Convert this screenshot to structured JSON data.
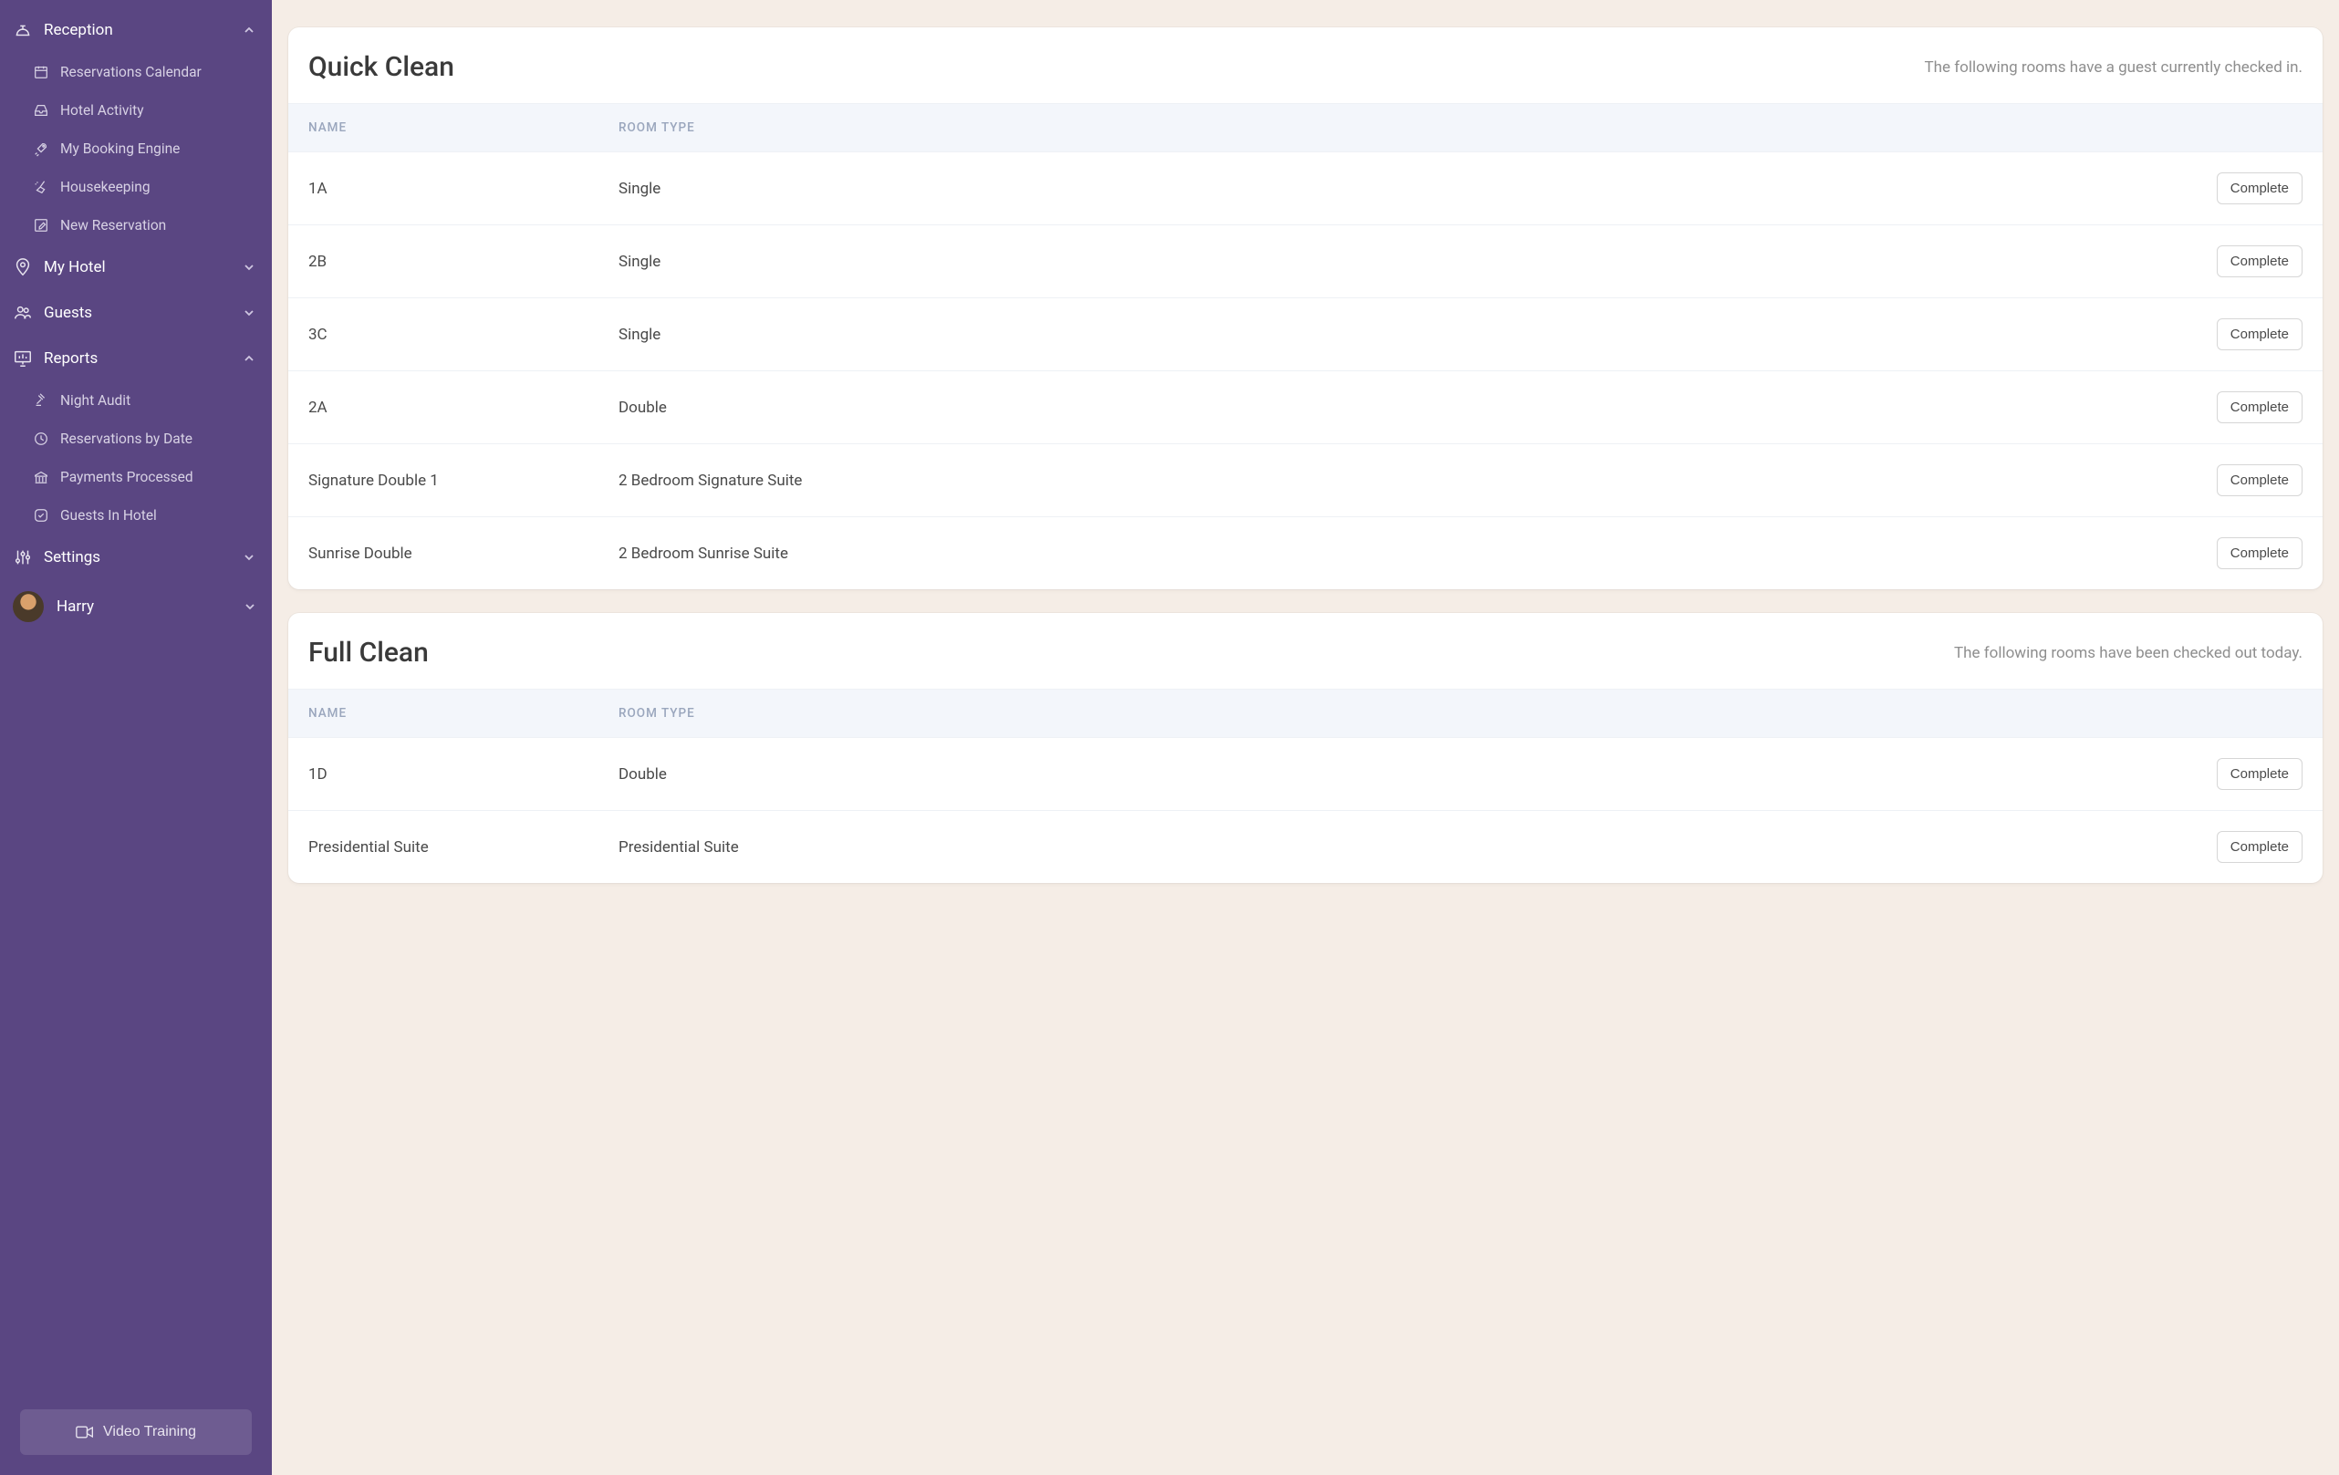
{
  "sidebar": {
    "reception": {
      "label": "Reception",
      "items": [
        {
          "label": "Reservations Calendar"
        },
        {
          "label": "Hotel Activity"
        },
        {
          "label": "My Booking Engine"
        },
        {
          "label": "Housekeeping"
        },
        {
          "label": "New Reservation"
        }
      ]
    },
    "my_hotel": {
      "label": "My Hotel"
    },
    "guests": {
      "label": "Guests"
    },
    "reports": {
      "label": "Reports",
      "items": [
        {
          "label": "Night Audit"
        },
        {
          "label": "Reservations by Date"
        },
        {
          "label": "Payments Processed"
        },
        {
          "label": "Guests In Hotel"
        }
      ]
    },
    "settings": {
      "label": "Settings"
    },
    "user": {
      "name": "Harry"
    },
    "video_training_label": "Video Training"
  },
  "quick_clean": {
    "title": "Quick Clean",
    "subtitle": "The following rooms have a guest currently checked in.",
    "columns": {
      "name": "Name",
      "type": "Room Type"
    },
    "complete_label": "Complete",
    "rows": [
      {
        "name": "1A",
        "type": "Single"
      },
      {
        "name": "2B",
        "type": "Single"
      },
      {
        "name": "3C",
        "type": "Single"
      },
      {
        "name": "2A",
        "type": "Double"
      },
      {
        "name": "Signature Double 1",
        "type": "2 Bedroom Signature Suite"
      },
      {
        "name": "Sunrise Double",
        "type": "2 Bedroom Sunrise Suite"
      }
    ]
  },
  "full_clean": {
    "title": "Full Clean",
    "subtitle": "The following rooms have been checked out today.",
    "columns": {
      "name": "Name",
      "type": "Room Type"
    },
    "complete_label": "Complete",
    "rows": [
      {
        "name": "1D",
        "type": "Double"
      },
      {
        "name": "Presidential Suite",
        "type": "Presidential Suite"
      }
    ]
  }
}
